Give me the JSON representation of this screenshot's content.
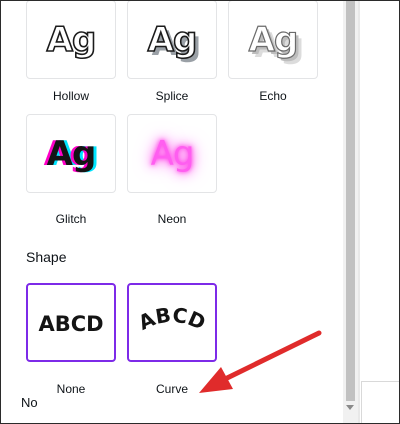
{
  "effects": {
    "tiles": [
      {
        "label": "Hollow",
        "preview_text": "Ag",
        "style": "hollow"
      },
      {
        "label": "Splice",
        "preview_text": "Ag",
        "style": "splice"
      },
      {
        "label": "Echo",
        "preview_text": "Ag",
        "style": "echo"
      },
      {
        "label": "Glitch",
        "preview_text": "Ag",
        "style": "glitch"
      },
      {
        "label": "Neon",
        "preview_text": "Ag",
        "style": "neon"
      }
    ]
  },
  "shape": {
    "section_title": "Shape",
    "options": [
      {
        "label": "None",
        "preview_text": "ABCD",
        "selected": true
      },
      {
        "label": "Curve",
        "preview_text": "ABCD",
        "selected": true
      }
    ]
  },
  "right_panel": {
    "partial_text": "No"
  },
  "colors": {
    "accent": "#7d2ae8",
    "annotation_arrow": "#e02b2b",
    "neon": "#ff3de8",
    "glitch_magenta": "#ff00c8",
    "glitch_cyan": "#00e5ff"
  }
}
